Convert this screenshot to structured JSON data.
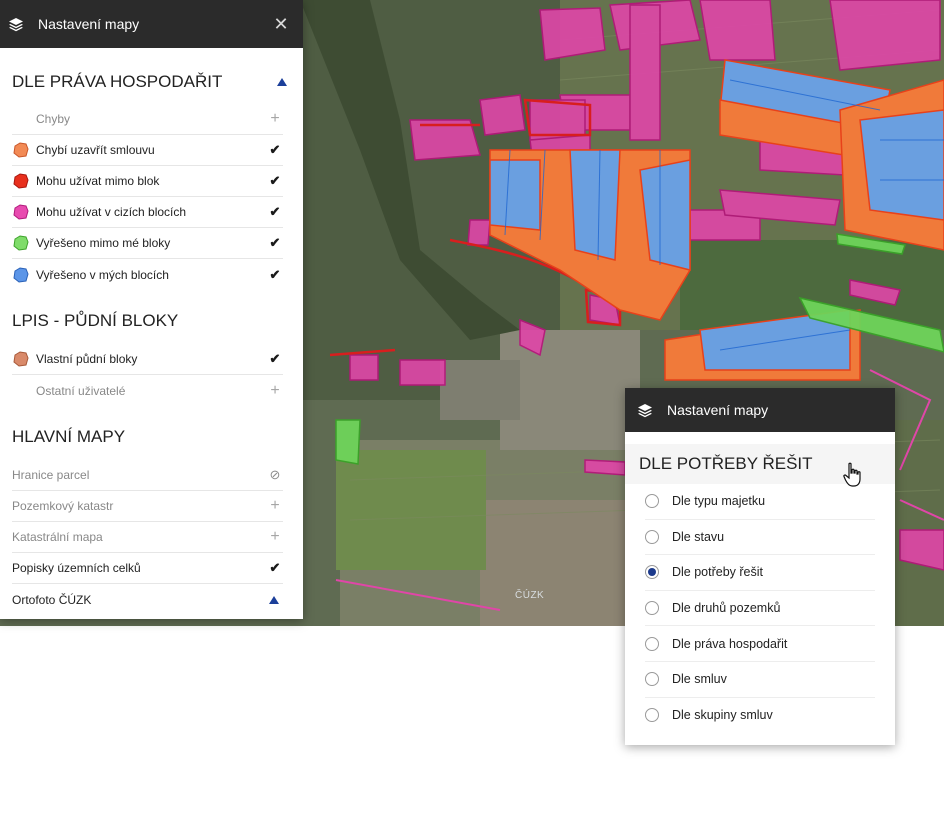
{
  "left_panel": {
    "title": "Nastavení mapy",
    "close_icon": "close-icon",
    "sections": [
      {
        "title": "DLE PRÁVA HOSPODAŘIT",
        "collapse_icon": "triangle-up-icon",
        "items": [
          {
            "label": "Chyby",
            "status": "plus",
            "swatch": ""
          },
          {
            "label": "Chybí uzavřít smlouvu",
            "status": "check",
            "swatch": "#f28a55"
          },
          {
            "label": "Mohu užívat mimo blok",
            "status": "check",
            "swatch": "#e8301d"
          },
          {
            "label": "Mohu užívat v cizích blocích",
            "status": "check",
            "swatch": "#e84bb0"
          },
          {
            "label": "Vyřešeno mimo mé bloky",
            "status": "check",
            "swatch": "#7fdc6a"
          },
          {
            "label": "Vyřešeno v mých blocích",
            "status": "check",
            "swatch": "#5b95e8"
          }
        ]
      },
      {
        "title": "LPIS - PŮDNÍ BLOKY",
        "items": [
          {
            "label": "Vlastní půdní bloky",
            "status": "check",
            "swatch": "#d98a6a"
          },
          {
            "label": "Ostatní uživatelé",
            "status": "plus",
            "swatch": ""
          }
        ]
      },
      {
        "title": "HLAVNÍ MAPY",
        "items": [
          {
            "label": "Hranice parcel",
            "status": "ban"
          },
          {
            "label": "Pozemkový katastr",
            "status": "plus"
          },
          {
            "label": "Katastrální mapa",
            "status": "plus"
          },
          {
            "label": "Popisky územních celků",
            "status": "check"
          },
          {
            "label": "Ortofoto ČÚZK",
            "status": "triangle"
          }
        ]
      }
    ]
  },
  "right_panel": {
    "title": "Nastavení mapy",
    "section_title": "DLE POTŘEBY ŘEŠIT",
    "options": [
      {
        "label": "Dle typu majetku",
        "selected": false
      },
      {
        "label": "Dle stavu",
        "selected": false
      },
      {
        "label": "Dle potřeby řešit",
        "selected": true
      },
      {
        "label": "Dle druhů pozemků",
        "selected": false
      },
      {
        "label": "Dle práva hospodařit",
        "selected": false
      },
      {
        "label": "Dle smluv",
        "selected": false
      },
      {
        "label": "Dle skupiny smluv",
        "selected": false
      }
    ]
  },
  "map": {
    "watermark": "ČÚZK",
    "colors": {
      "orange": "#f07a3a",
      "blue": "#6a9fe0",
      "magenta": "#e046a8",
      "green": "#6ed45a",
      "red": "#d81e1e"
    }
  }
}
